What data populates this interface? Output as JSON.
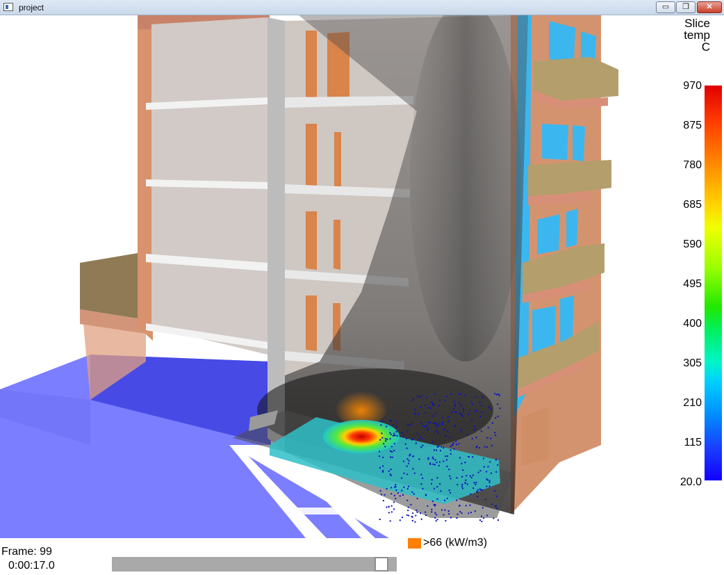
{
  "window": {
    "title": "project",
    "minimize_glyph": "▭",
    "restore_glyph": "❐",
    "close_glyph": "✕"
  },
  "colorbar": {
    "title_lines": [
      "Slice",
      "temp",
      "C"
    ],
    "ticks": [
      "970",
      "875",
      "780",
      "685",
      "590",
      "495",
      "400",
      "305",
      "210",
      "115",
      "20.0"
    ],
    "low_color": "#1200ff",
    "high_color": "#e00000"
  },
  "playback": {
    "frame_label": "Frame: 99",
    "time_label": "0:00:17.0",
    "progress_fraction": 0.97
  },
  "legend": {
    "hrr_label": ">66 (kW/m3)",
    "hrr_color": "#ff7f00"
  },
  "scene": {
    "slice_max_color": "#e00000",
    "ground_slice_color": "#6f73ff",
    "window_glass_color": "#3cb6ee",
    "brick_color": "#d49270",
    "balcony_color": "#b39e6c",
    "smoke_color": "#3a3a3a",
    "particle_color": "#0a10c0"
  }
}
